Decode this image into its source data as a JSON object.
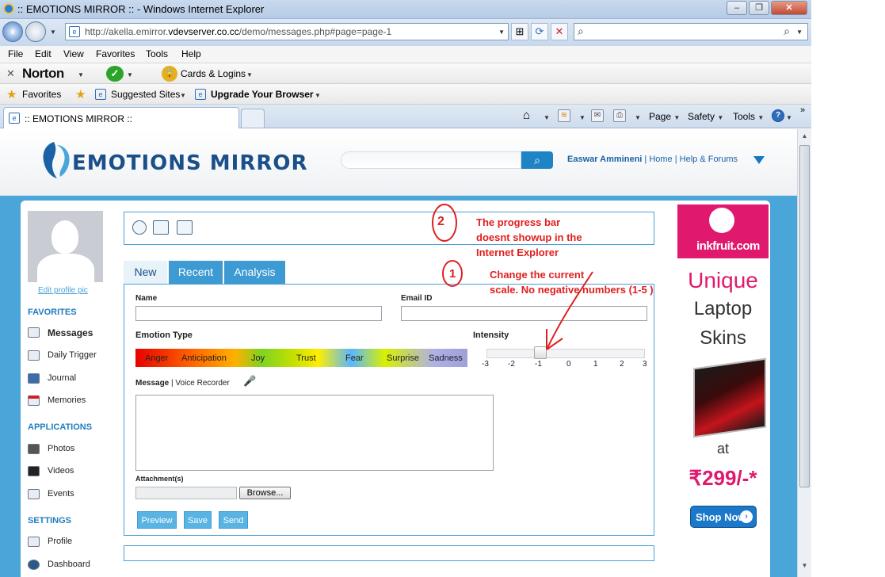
{
  "window": {
    "title": ":: EMOTIONS MIRROR :: - Windows Internet Explorer",
    "minimize": "–",
    "maximize": "❐",
    "close": "✕"
  },
  "addressbar": {
    "url_prefix": "http://akella.emirror.",
    "url_domain": "vdevserver.co.cc",
    "url_suffix": "/demo/messages.php#page=page-1"
  },
  "menu": [
    "File",
    "Edit",
    "View",
    "Favorites",
    "Tools",
    "Help"
  ],
  "norton": {
    "brand": "Norton",
    "cards": "Cards & Logins"
  },
  "favorites_bar": {
    "favorites": "Favorites",
    "suggested": "Suggested Sites",
    "upgrade": "Upgrade Your Browser"
  },
  "tab": {
    "title": ":: EMOTIONS MIRROR ::"
  },
  "command_bar": {
    "page": "Page",
    "safety": "Safety",
    "tools": "Tools"
  },
  "site": {
    "logo": "EMOTIONS MIRROR",
    "username": "Easwar Ammineni",
    "links": [
      " | Home",
      " | Help & Forums"
    ]
  },
  "sidebar": {
    "edit_pic": "Edit profile pic",
    "favorites_heading": "FAVORITES",
    "favorites": [
      "Messages",
      "Daily Trigger",
      "Journal",
      "Memories"
    ],
    "applications_heading": "APPLICATIONS",
    "applications": [
      "Photos",
      "Videos",
      "Events"
    ],
    "settings_heading": "SETTINGS",
    "settings": [
      "Profile",
      "Dashboard"
    ]
  },
  "tabs": [
    "New",
    "Recent",
    "Analysis"
  ],
  "form": {
    "name_label": "Name",
    "email_label": "Email ID",
    "emotion_label": "Emotion Type",
    "intensity_label": "Intensity",
    "emotions": [
      "Anger",
      "Anticipation",
      "Joy",
      "Trust",
      "Fear",
      "Surprise",
      "Sadness"
    ],
    "scale": [
      "-3",
      "-2",
      "-1",
      "0",
      "1",
      "2",
      "3"
    ],
    "message_label": "Message",
    "voice_label": "| Voice Recorder",
    "attachments_label": "Attachment(s)",
    "browse": "Browse...",
    "buttons": [
      "Preview",
      "Save",
      "Send"
    ]
  },
  "ad": {
    "brand": "inkfruit.com",
    "line1": "Unique",
    "line2": "Laptop",
    "line3": "Skins",
    "at": "at",
    "price": "₹299/-*",
    "cta": "Shop Now"
  },
  "annotations": {
    "num2": "2",
    "note2": [
      "The progress bar",
      "doesnt showup in the",
      "Internet Explorer"
    ],
    "num1": "1",
    "note1": [
      "Change the current",
      "scale.    No negative numbers  (1-5 )"
    ]
  },
  "colors": {
    "site_blue": "#4aa6d8",
    "accent_pink": "#e0196f",
    "annotation_red": "#e02020"
  }
}
